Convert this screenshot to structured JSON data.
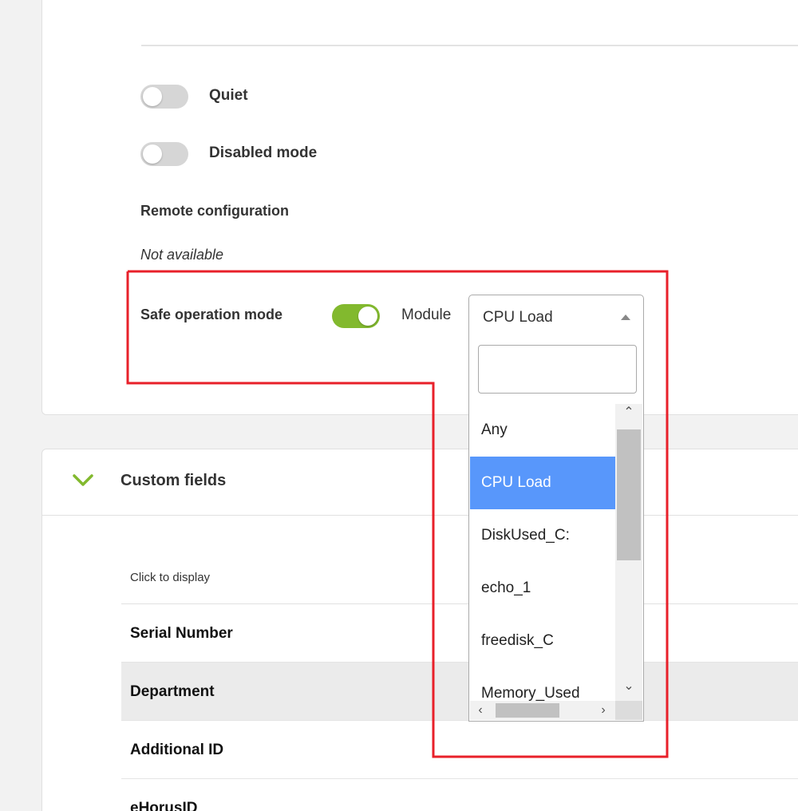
{
  "toggles": {
    "quiet": {
      "label": "Quiet",
      "on": false
    },
    "disabled_mode": {
      "label": "Disabled mode",
      "on": false
    },
    "safe_operation_mode": {
      "label": "Safe operation mode",
      "on": true
    }
  },
  "remote_configuration": {
    "label": "Remote configuration",
    "value": "Not available"
  },
  "module": {
    "label": "Module",
    "selected": "CPU Load",
    "search_value": "",
    "options": [
      "Any",
      "CPU Load",
      "DiskUsed_C:",
      "echo_1",
      "freedisk_C",
      "Memory_Used"
    ]
  },
  "custom_fields": {
    "title": "Custom fields",
    "column_header": "Click to display",
    "rows": [
      "Serial Number",
      "Department",
      "Additional ID",
      "eHorusID"
    ]
  },
  "colors": {
    "toggle_on": "#82b92e",
    "selected_option": "#5897fb",
    "highlight_border": "#e8202a",
    "chevron": "#82b92e"
  },
  "icons": {
    "search": "search-icon",
    "chevron": "chevron-down-icon",
    "select_arrow": "triangle-up-icon"
  }
}
